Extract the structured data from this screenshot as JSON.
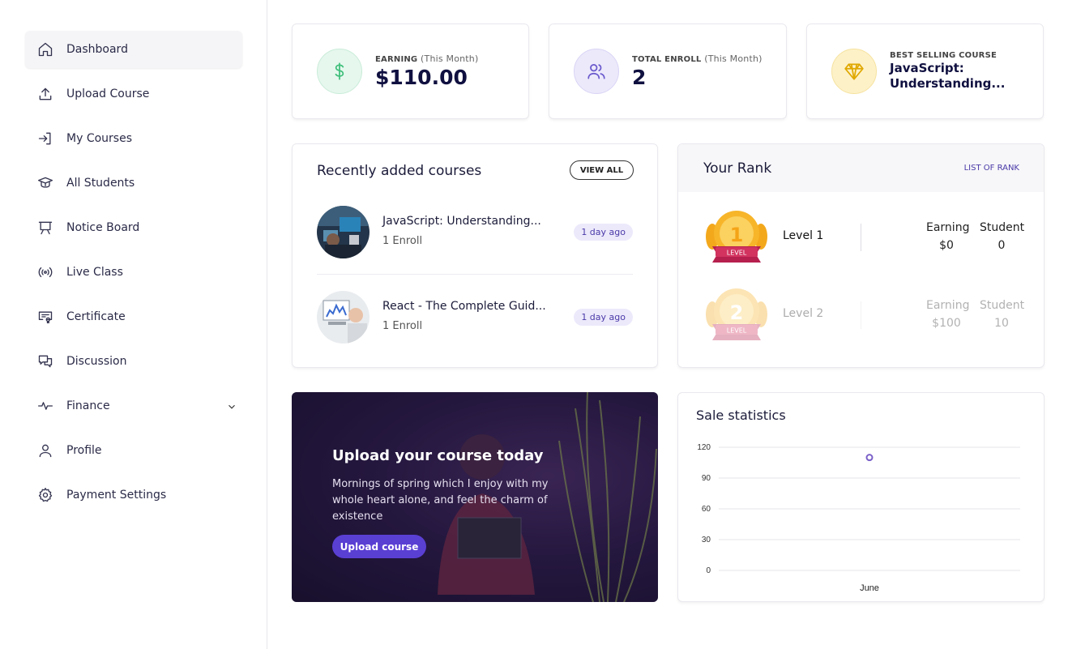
{
  "sidebar": {
    "items": [
      {
        "label": "Dashboard",
        "icon": "home-icon",
        "active": true
      },
      {
        "label": "Upload Course",
        "icon": "upload-icon"
      },
      {
        "label": "My Courses",
        "icon": "login-arrow-icon"
      },
      {
        "label": "All Students",
        "icon": "graduation-cap-icon"
      },
      {
        "label": "Notice Board",
        "icon": "presentation-board-icon"
      },
      {
        "label": "Live Class",
        "icon": "broadcast-icon"
      },
      {
        "label": "Certificate",
        "icon": "certificate-icon"
      },
      {
        "label": "Discussion",
        "icon": "chat-bubbles-icon"
      },
      {
        "label": "Finance",
        "icon": "activity-pulse-icon",
        "has_submenu": true
      },
      {
        "label": "Profile",
        "icon": "user-icon"
      },
      {
        "label": "Payment Settings",
        "icon": "gear-icon"
      }
    ]
  },
  "stats": {
    "earning": {
      "label": "EARNING",
      "sub": "(This Month)",
      "value": "$110.00",
      "icon": "dollar-icon",
      "color": "#3fbf7a"
    },
    "enroll": {
      "label": "TOTAL ENROLL",
      "sub": "(This Month)",
      "value": "2",
      "icon": "users-icon",
      "color": "#6a5acd"
    },
    "best": {
      "label": "BEST SELLING COURSE",
      "value": "JavaScript: Understanding...",
      "icon": "diamond-icon",
      "color": "#e0a800"
    }
  },
  "recent": {
    "title": "Recently added courses",
    "view_all": "VIEW ALL",
    "courses": [
      {
        "title": "JavaScript: Understanding...",
        "enroll": "1 Enroll",
        "time": "1 day ago"
      },
      {
        "title": "React - The Complete Guid...",
        "enroll": "1 Enroll",
        "time": "1 day ago"
      }
    ]
  },
  "rank": {
    "title": "Your Rank",
    "link": "LIST OF RANK",
    "earning_label": "Earning",
    "student_label": "Student",
    "levels": [
      {
        "number": "1",
        "medal_text": "LEVEL",
        "name": "Level 1",
        "earning": "$0",
        "students": "0"
      },
      {
        "number": "2",
        "medal_text": "LEVEL",
        "name": "Level 2",
        "earning": "$100",
        "students": "10"
      }
    ]
  },
  "promo": {
    "title": "Upload your course today",
    "text": "Mornings of spring which I enjoy with my whole heart alone, and feel the charm of existence",
    "button": "Upload course"
  },
  "sale_stats": {
    "title": "Sale statistics"
  },
  "chart_data": {
    "type": "scatter",
    "title": "Sale statistics",
    "categories": [
      "June"
    ],
    "series": [
      {
        "values": [
          110
        ]
      }
    ],
    "ylim": [
      0,
      120
    ],
    "yticks": [
      0,
      30,
      60,
      90,
      120
    ],
    "grid": true,
    "color": "#7b61c9"
  }
}
